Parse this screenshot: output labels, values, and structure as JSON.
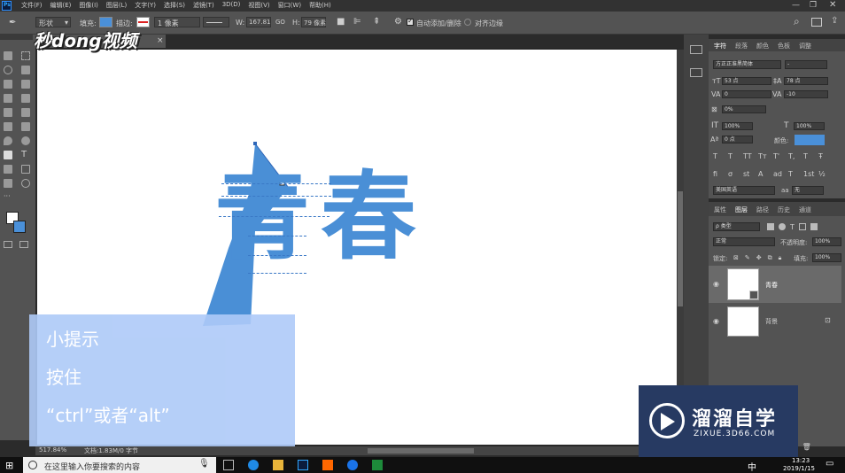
{
  "app": {
    "ps_logo": "Ps"
  },
  "menu": [
    "文件(F)",
    "编辑(E)",
    "图像(I)",
    "图层(L)",
    "文字(Y)",
    "选择(S)",
    "滤镜(T)",
    "3D(D)",
    "视图(V)",
    "窗口(W)",
    "帮助(H)"
  ],
  "options": {
    "mode": "形状",
    "fill_label": "填充:",
    "stroke_label": "描边:",
    "stroke_width": "1 像素",
    "w_label": "W:",
    "w_value": "167.81",
    "go_label": "GO",
    "h_label": "H:",
    "h_value": "79 像素",
    "auto_add": "自动添加/删除",
    "align_edges": "对齐边缘"
  },
  "watermark": {
    "text": "秒dong视频"
  },
  "canvas_text": "青春",
  "tip": {
    "title": "小提示",
    "line1": "按住",
    "line2": "“ctrl”或者“alt”"
  },
  "char_panel": {
    "tabs": [
      "字符",
      "段落",
      "颜色",
      "色板",
      "调整"
    ],
    "font": "方正正准黑简体",
    "font_style": "-",
    "size": "53 点",
    "leading": "78 点",
    "kerning": "0",
    "tracking": "-10",
    "vscale_pct": "0%",
    "hscale": "100%",
    "vscale": "100%",
    "baseline": "0 点",
    "color_label": "颜色:",
    "language": "美国英语",
    "aa_label": "aa",
    "aa_value": "无",
    "fx_buttons": [
      "T",
      "T",
      "TT",
      "Tт",
      "T'",
      "T,",
      "T",
      "Ŧ"
    ],
    "opentype_buttons": [
      "fi",
      "σ",
      "st",
      "A",
      "ad",
      "T",
      "1st",
      "½"
    ]
  },
  "layers_panel": {
    "tabs": [
      "属性",
      "图层",
      "路径",
      "历史",
      "通道"
    ],
    "filter": "ρ 类型",
    "blend_mode": "正常",
    "opacity_label": "不透明度:",
    "opacity": "100%",
    "lock_label": "锁定:",
    "fill_label": "填充:",
    "fill": "100%",
    "layers": [
      {
        "name": "青春",
        "selected": true
      },
      {
        "name": "背景",
        "selected": false
      }
    ]
  },
  "status": {
    "zoom": "517.84%",
    "doc": "文档:1.83M/0 字节"
  },
  "taskbar": {
    "search_placeholder": "在这里输入你要搜索的内容",
    "ime": "中",
    "time": "13:23",
    "date": "2019/1/15"
  },
  "brand": {
    "title": "溜溜自学",
    "url": "ZIXUE.3D66.COM"
  },
  "colors": {
    "accent": "#4a90d9",
    "canvas_text": "#4a8fd6",
    "tip_bg": "#aecaf8",
    "brand_bg": "#273a62"
  }
}
